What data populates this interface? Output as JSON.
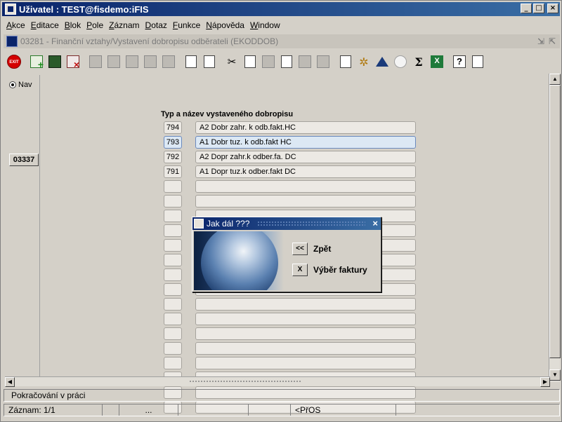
{
  "window": {
    "title": "Uživatel : TEST@fisdemo:iFIS",
    "minimize": "_",
    "maximize": "□",
    "close": "×"
  },
  "menu": [
    {
      "pre": "",
      "u": "A",
      "post": "kce"
    },
    {
      "pre": "",
      "u": "E",
      "post": "ditace"
    },
    {
      "pre": "",
      "u": "B",
      "post": "lok"
    },
    {
      "pre": "",
      "u": "P",
      "post": "ole"
    },
    {
      "pre": "",
      "u": "Z",
      "post": "áznam"
    },
    {
      "pre": "",
      "u": "D",
      "post": "otaz"
    },
    {
      "pre": "",
      "u": "F",
      "post": "unkce"
    },
    {
      "pre": "",
      "u": "N",
      "post": "ápověda"
    },
    {
      "pre": "",
      "u": "W",
      "post": "indow"
    }
  ],
  "form": {
    "title": "03281 - Finanční vztahy/Vystavení dobropisu odběrateli (EKODDOB)",
    "ctrl_min": "⇲",
    "ctrl_max": "⇱"
  },
  "toolbar": {
    "exit_label": "EXIT"
  },
  "left_panel": {
    "radio_label": "Nav",
    "code": "03337"
  },
  "grid": {
    "header": "Typ a název vystaveného dobropisu",
    "rows": [
      {
        "num": "794",
        "name": "A2 Dobr zahr. k odb.fakt.HC"
      },
      {
        "num": "793",
        "name": "A1 Dobr tuz. k odb.fakt HC"
      },
      {
        "num": "792",
        "name": "A2 Dopr zahr.k odber.fa. DC"
      },
      {
        "num": "791",
        "name": "A1 Dopr tuz.k odber.fakt DC"
      },
      {
        "num": "",
        "name": ""
      },
      {
        "num": "",
        "name": ""
      },
      {
        "num": "",
        "name": ""
      },
      {
        "num": "",
        "name": ""
      },
      {
        "num": "",
        "name": ""
      },
      {
        "num": "",
        "name": ""
      },
      {
        "num": "",
        "name": ""
      },
      {
        "num": "",
        "name": ""
      },
      {
        "num": "",
        "name": ""
      },
      {
        "num": "",
        "name": ""
      },
      {
        "num": "",
        "name": ""
      },
      {
        "num": "",
        "name": ""
      },
      {
        "num": "",
        "name": ""
      },
      {
        "num": "",
        "name": ""
      },
      {
        "num": "",
        "name": ""
      },
      {
        "num": "",
        "name": ""
      }
    ]
  },
  "dialog": {
    "title": "Jak dál ???",
    "close": "×",
    "back_icon": "<<",
    "back_label": "Zpět",
    "select_icon": "X",
    "select_label": "Výběr faktury"
  },
  "status": {
    "message": "Pokračování v práci",
    "record": "Záznam: 1/1",
    "field3": "...",
    "field6": "<PřOS"
  },
  "colors": {
    "title_bar": "#0a246a",
    "active_row": "#dce8f4"
  }
}
